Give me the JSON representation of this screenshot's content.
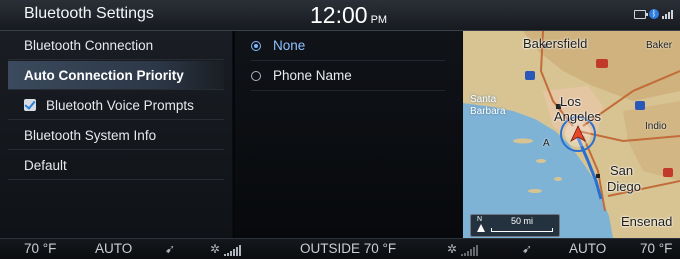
{
  "header": {
    "title": "Bluetooth Settings",
    "time": "12:00",
    "ampm": "PM",
    "status_icons": [
      "battery-icon",
      "bluetooth-icon",
      "signal-icon"
    ]
  },
  "menu": {
    "items": [
      {
        "label": "Bluetooth Connection",
        "active": false
      },
      {
        "label": "Auto Connection Priority",
        "active": true
      },
      {
        "label": "Bluetooth Voice Prompts",
        "checked": true
      },
      {
        "label": "Bluetooth System Info"
      },
      {
        "label": "Default"
      }
    ]
  },
  "options": {
    "items": [
      {
        "label": "None",
        "selected": true
      },
      {
        "label": "Phone Name",
        "selected": false
      }
    ]
  },
  "map": {
    "labels": {
      "bakersfield": "Bakersfield",
      "baker": "Baker",
      "santa_barbara_1": "Santa",
      "santa_barbara_2": "Barbara",
      "los": "Los",
      "angeles": "Angeles",
      "indio": "Indio",
      "san": "San",
      "diego": "Diego",
      "ensenada": "Ensenad",
      "a": "A"
    },
    "highway_shields": [
      "5",
      "40",
      "15",
      "10",
      "8"
    ],
    "scale": {
      "north": "N",
      "distance": "50 mi"
    }
  },
  "climate": {
    "left_temp": "70 °F",
    "left_mode": "AUTO",
    "outside": "OUTSIDE  70 °F",
    "right_mode": "AUTO",
    "right_temp": "70 °F"
  },
  "colors": {
    "accent": "#2c7fd6",
    "selected_text": "#8fc0ff",
    "active_row": "#3b4a5e"
  }
}
